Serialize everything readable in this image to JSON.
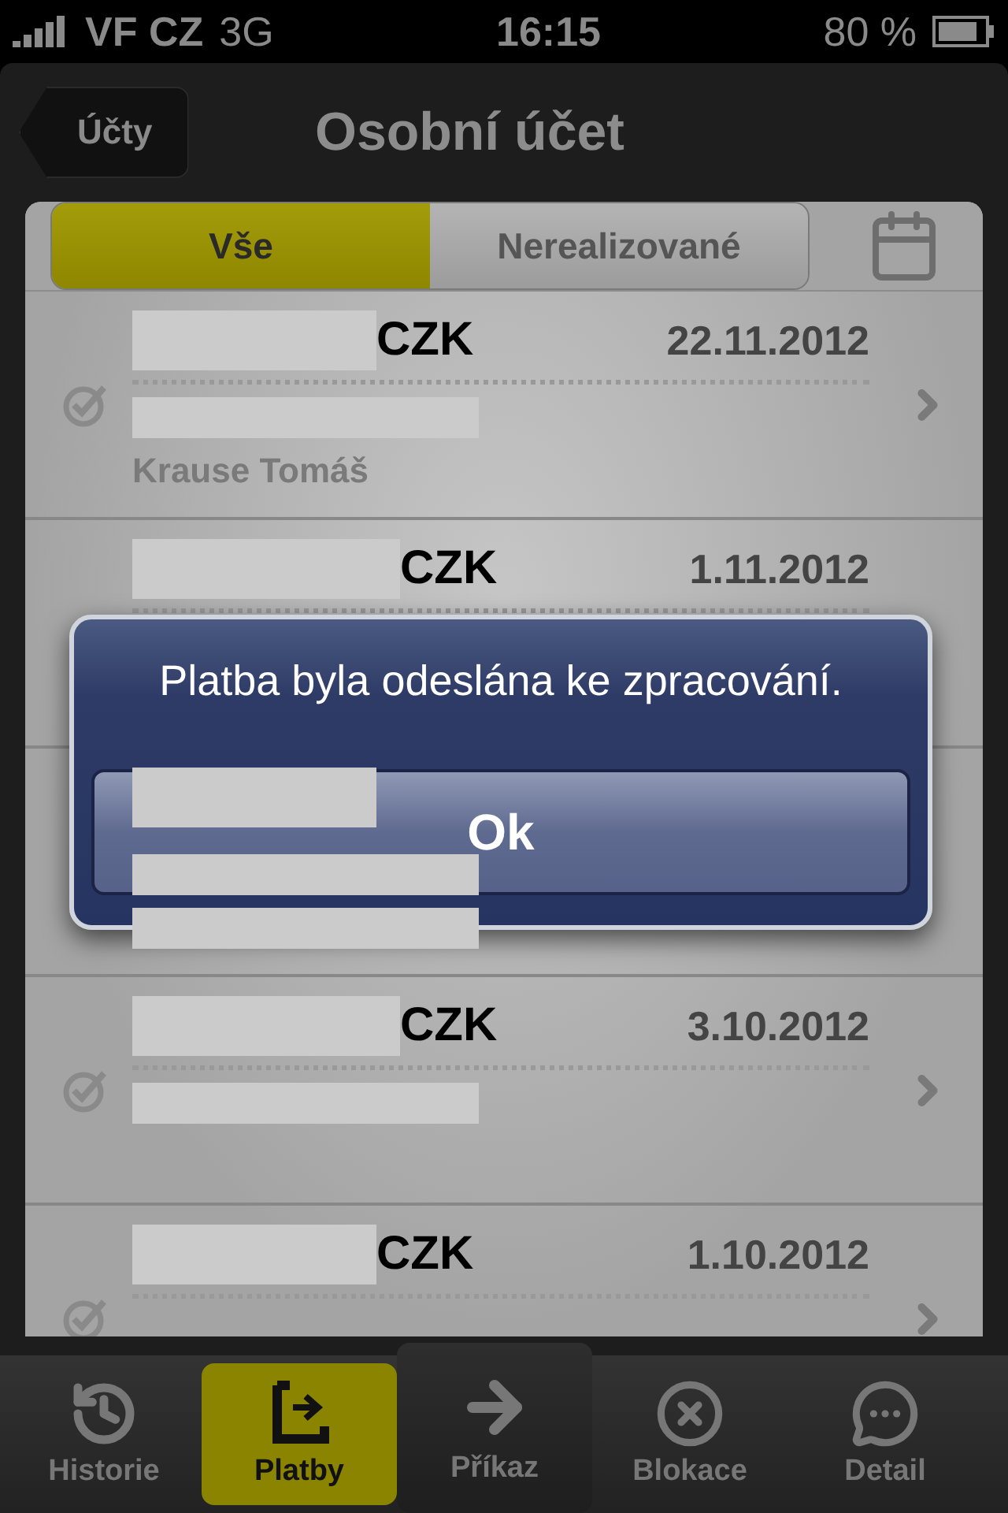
{
  "status_bar": {
    "carrier": "VF CZ",
    "network": "3G",
    "time": "16:15",
    "battery": "80 %"
  },
  "nav_bar": {
    "back": "Účty",
    "title": "Osobní účet"
  },
  "segments": [
    {
      "label": "Vše",
      "selected": true
    },
    {
      "label": "Nerealizované",
      "selected": false
    }
  ],
  "rows": [
    {
      "currency": "CZK",
      "date": "22.11.2012",
      "lines": [
        {
          "kind": "redacted"
        },
        {
          "kind": "text",
          "text": "Krause Tomáš"
        }
      ]
    },
    {
      "currency": "CZK",
      "date": "1.11.2012",
      "icons_visible": false,
      "lines": []
    },
    {
      "icons_visible": false,
      "lines": [
        {
          "kind": "redacted"
        },
        {
          "kind": "redacted"
        }
      ]
    },
    {
      "currency": "CZK",
      "date": "3.10.2012",
      "lines": [
        {
          "kind": "redacted"
        }
      ]
    },
    {
      "currency": "CZK",
      "date": "1.10.2012",
      "lines": []
    }
  ],
  "alert": {
    "message": "Platba byla odeslána ke zpracování.",
    "button": "Ok"
  },
  "tab_bar": [
    {
      "label": "Historie",
      "selected": false,
      "kind": "tab"
    },
    {
      "label": "Platby",
      "selected": true,
      "kind": "tab"
    },
    {
      "label": "Příkaz",
      "selected": false,
      "kind": "raised"
    },
    {
      "label": "Blokace",
      "selected": false,
      "kind": "tab"
    },
    {
      "label": "Detail",
      "selected": false,
      "kind": "tab"
    }
  ]
}
